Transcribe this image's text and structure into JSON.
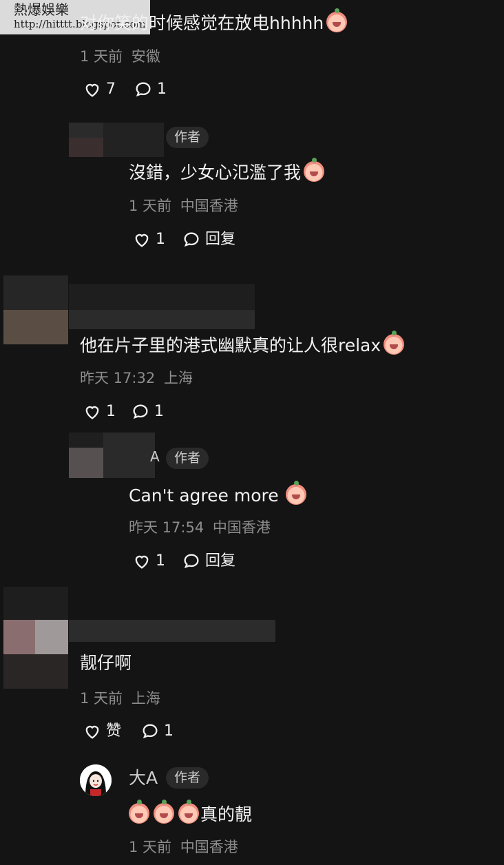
{
  "watermark": {
    "title": "熱爆娛樂",
    "url": "http://hitttt.blogspot.com"
  },
  "comments": [
    {
      "text": "对你笑的时候感觉在放电hhhhh",
      "time": "1 天前",
      "location": "安徽",
      "likes": "7",
      "replies": "1",
      "emoji": "heart-eyes-emoji"
    },
    {
      "badge": "作者",
      "text": "沒錯，少女心氾濫了我",
      "time": "1 天前",
      "location": "中国香港",
      "likes": "1",
      "reply_label": "回复",
      "emoji": "shy-emoji"
    },
    {
      "text": "他在片子里的港式幽默真的让人很relax",
      "time": "昨天 17:32",
      "location": "上海",
      "likes": "1",
      "replies": "1",
      "emoji": "laughing-emoji"
    },
    {
      "author": "A",
      "badge": "作者",
      "text": "Can't agree more",
      "time": "昨天 17:54",
      "location": "中国香港",
      "likes": "1",
      "reply_label": "回复",
      "emoji": "shy-emoji"
    },
    {
      "text": "靓仔啊",
      "time": "1 天前",
      "location": "上海",
      "like_label": "赞",
      "replies": "1"
    },
    {
      "author": "大A",
      "badge": "作者",
      "text": "真的靚",
      "time": "1 天前",
      "location": "中国香港",
      "emoji": "shy-emoji"
    }
  ],
  "icons": {
    "like": "heart-icon",
    "comment": "comment-bubble-icon"
  },
  "colors": {
    "background": "#141414",
    "text": "#f2f2f2",
    "meta": "#8d8d8d",
    "badge": "#2a2a2a"
  }
}
